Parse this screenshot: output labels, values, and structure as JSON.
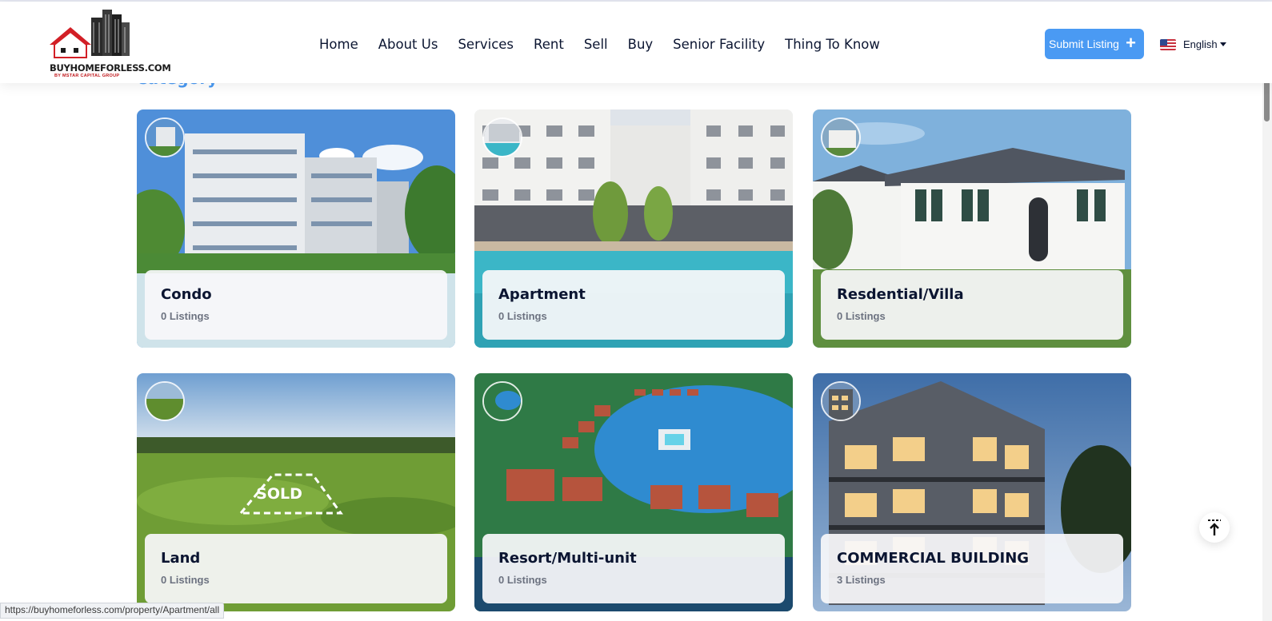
{
  "header": {
    "logo_text": "BUYHOMEFORLESS.COM",
    "logo_subtext": "BY MSTAR CAPITAL GROUP",
    "nav": [
      "Home",
      "About Us",
      "Services",
      "Rent",
      "Sell",
      "Buy",
      "Senior Facility",
      "Thing To Know"
    ],
    "submit_label": "Submit Listing",
    "submit_icon": "plus-icon",
    "language": "English"
  },
  "section": {
    "heading": "Category"
  },
  "categories": [
    {
      "title": "Condo",
      "count": "0 Listings"
    },
    {
      "title": "Apartment",
      "count": "0 Listings"
    },
    {
      "title": "Resdential/Villa",
      "count": "0 Listings"
    },
    {
      "title": "Land",
      "count": "0 Listings",
      "overlay_text": "SOLD"
    },
    {
      "title": "Resort/Multi-unit",
      "count": "0 Listings"
    },
    {
      "title": "COMMERCIAL BUILDING",
      "count": "3 Listings"
    }
  ],
  "status_bar": {
    "url": "https://buyhomeforless.com/property/Apartment/all"
  },
  "colors": {
    "accent": "#4a9af3",
    "text_dark": "#0b1531",
    "logo_red": "#d21f26"
  }
}
